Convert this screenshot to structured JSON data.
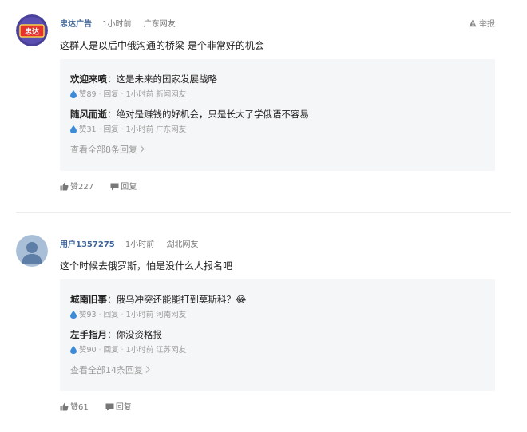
{
  "report_label": "举报",
  "comments": [
    {
      "user": "忠达广告",
      "avatar_text": "忠达",
      "time": "1小时前",
      "location": "广东网友",
      "content": "这群人是以后中俄沟通的桥梁 是个非常好的机会",
      "replies": [
        {
          "name": "欢迎来喷",
          "text": "：这是未来的国家发展战略",
          "likes": "赞89",
          "reply_label": "回复",
          "time": "1小时前",
          "location": "新闻网友"
        },
        {
          "name": "随风而逝",
          "text": "：绝对是赚钱的好机会，只是长大了学俄语不容易",
          "likes": "赞31",
          "reply_label": "回复",
          "time": "1小时前",
          "location": "广东网友"
        }
      ],
      "view_all": "查看全部8条回复",
      "likes": "赞227",
      "reply_label": "回复"
    },
    {
      "user": "用户1357275",
      "time": "1小时前",
      "location": "湖北网友",
      "content": "这个时候去俄罗斯，怕是没什么人报名吧",
      "replies": [
        {
          "name": "城南旧事",
          "text": "：俄乌冲突还能能打到莫斯科？😂",
          "likes": "赞93",
          "reply_label": "回复",
          "time": "1小时前",
          "location": "河南网友"
        },
        {
          "name": "左手指月",
          "text": "：你没资格报",
          "likes": "赞90",
          "reply_label": "回复",
          "time": "1小时前",
          "location": "江苏网友"
        }
      ],
      "view_all": "查看全部14条回复",
      "likes": "赞61",
      "reply_label": "回复"
    }
  ],
  "colors": {
    "username": "#406599",
    "like_drop": "#3d8bd8",
    "reply_bg": "#f5f6f7",
    "avatar1_bg": "#4a3f9a",
    "avatar1_badge": "#e6322b",
    "avatar2_bg": "#a9bfd8"
  },
  "icons": {
    "report": "warning-triangle-icon",
    "reply_like": "water-drop-icon",
    "like": "thumbs-up-icon",
    "comment": "speech-bubble-icon",
    "chevron": "chevron-right-icon"
  }
}
